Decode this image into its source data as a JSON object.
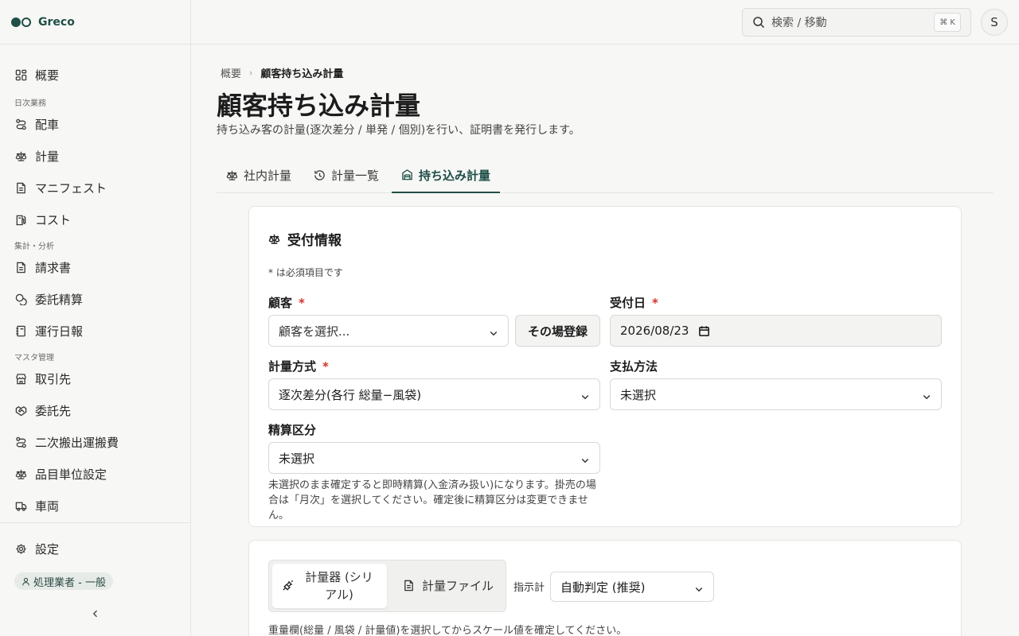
{
  "brand": {
    "name": "Greco"
  },
  "sidebar": {
    "top_item": {
      "label": "概要",
      "icon": "grid-icon"
    },
    "sections": [
      {
        "title": "日次業務",
        "items": [
          {
            "label": "配車",
            "icon": "route-icon"
          },
          {
            "label": "計量",
            "icon": "scale-icon"
          },
          {
            "label": "マニフェスト",
            "icon": "document-icon"
          },
          {
            "label": "コスト",
            "icon": "fuel-icon"
          }
        ]
      },
      {
        "title": "集計・分析",
        "items": [
          {
            "label": "請求書",
            "icon": "document-icon"
          },
          {
            "label": "委託精算",
            "icon": "coins-icon"
          },
          {
            "label": "運行日報",
            "icon": "notebook-icon"
          }
        ]
      },
      {
        "title": "マスタ管理",
        "items": [
          {
            "label": "取引先",
            "icon": "store-icon"
          },
          {
            "label": "委託先",
            "icon": "handshake-icon"
          },
          {
            "label": "二次搬出運搬費",
            "icon": "route-icon"
          },
          {
            "label": "品目単位設定",
            "icon": "scale-icon"
          },
          {
            "label": "車両",
            "icon": "truck-icon"
          }
        ]
      }
    ],
    "settings": {
      "label": "設定",
      "icon": "gear-icon"
    },
    "role_badge": "処理業者 - 一般"
  },
  "topbar": {
    "search_placeholder": "検索 / 移動",
    "shortcut": "⌘ K",
    "avatar_initial": "S"
  },
  "breadcrumb": {
    "root": "概要",
    "current": "顧客持ち込み計量"
  },
  "page": {
    "title": "顧客持ち込み計量",
    "subtitle": "持ち込み客の計量(逐次差分 / 単発 / 個別)を行い、証明書を発行します。"
  },
  "tabs": [
    {
      "label": "社内計量",
      "icon": "scale-icon",
      "active": false
    },
    {
      "label": "計量一覧",
      "icon": "history-icon",
      "active": false
    },
    {
      "label": "持ち込み計量",
      "icon": "inbox-icon",
      "active": true
    }
  ],
  "reception": {
    "title": "受付情報",
    "required_note": "* は必須項目です",
    "customer_label": "顧客",
    "customer_value": "顧客を選択...",
    "register_button": "その場登録",
    "date_label": "受付日",
    "date_value": "2026/08/23",
    "method_label": "計量方式",
    "method_value": "逐次差分(各行 総量−風袋)",
    "payment_label": "支払方法",
    "payment_value": "未選択",
    "settlement_label": "精算区分",
    "settlement_value": "未選択",
    "settlement_hint": "未選択のまま確定すると即時精算(入金済み扱い)になります。掛売の場合は「月次」を選択してください。確定後に精算区分は変更できません。",
    "required_mark": "*"
  },
  "measure": {
    "device_tab": "計量器 (シリアル)",
    "file_tab": "計量ファイル",
    "indicator_label": "指示計",
    "indicator_value": "自動判定 (推奨)",
    "weight_hint": "重量欄(総量 / 風袋 / 計量値)を選択してからスケール値を確定してください。"
  },
  "colors": {
    "accent": "#1f4f47",
    "required": "#d0342c"
  }
}
